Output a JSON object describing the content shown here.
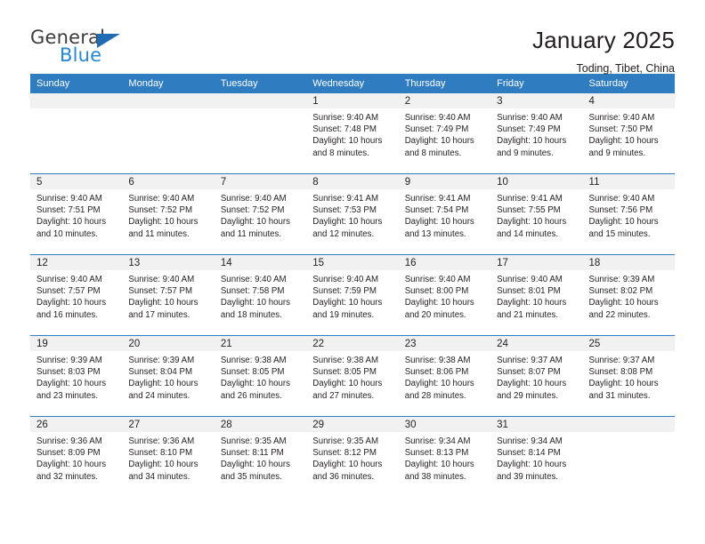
{
  "logo": {
    "word_one": "General",
    "word_two": "Blue",
    "triangle_color": "#1f6cb4",
    "blue_text_color": "#2586d4"
  },
  "header": {
    "title": "January 2025",
    "location": "Toding, Tibet, China",
    "accent_color": "#2f7cc0",
    "band_color": "#f1f1f1"
  },
  "calendar": {
    "weekday_headers": [
      "Sunday",
      "Monday",
      "Tuesday",
      "Wednesday",
      "Thursday",
      "Friday",
      "Saturday"
    ],
    "weeks": [
      [
        {
          "day": "",
          "sunrise": "",
          "sunset": "",
          "daylight_line1": "",
          "daylight_line2": ""
        },
        {
          "day": "",
          "sunrise": "",
          "sunset": "",
          "daylight_line1": "",
          "daylight_line2": ""
        },
        {
          "day": "",
          "sunrise": "",
          "sunset": "",
          "daylight_line1": "",
          "daylight_line2": ""
        },
        {
          "day": "1",
          "sunrise": "Sunrise: 9:40 AM",
          "sunset": "Sunset: 7:48 PM",
          "daylight_line1": "Daylight: 10 hours",
          "daylight_line2": "and 8 minutes."
        },
        {
          "day": "2",
          "sunrise": "Sunrise: 9:40 AM",
          "sunset": "Sunset: 7:49 PM",
          "daylight_line1": "Daylight: 10 hours",
          "daylight_line2": "and 8 minutes."
        },
        {
          "day": "3",
          "sunrise": "Sunrise: 9:40 AM",
          "sunset": "Sunset: 7:49 PM",
          "daylight_line1": "Daylight: 10 hours",
          "daylight_line2": "and 9 minutes."
        },
        {
          "day": "4",
          "sunrise": "Sunrise: 9:40 AM",
          "sunset": "Sunset: 7:50 PM",
          "daylight_line1": "Daylight: 10 hours",
          "daylight_line2": "and 9 minutes."
        }
      ],
      [
        {
          "day": "5",
          "sunrise": "Sunrise: 9:40 AM",
          "sunset": "Sunset: 7:51 PM",
          "daylight_line1": "Daylight: 10 hours",
          "daylight_line2": "and 10 minutes."
        },
        {
          "day": "6",
          "sunrise": "Sunrise: 9:40 AM",
          "sunset": "Sunset: 7:52 PM",
          "daylight_line1": "Daylight: 10 hours",
          "daylight_line2": "and 11 minutes."
        },
        {
          "day": "7",
          "sunrise": "Sunrise: 9:40 AM",
          "sunset": "Sunset: 7:52 PM",
          "daylight_line1": "Daylight: 10 hours",
          "daylight_line2": "and 11 minutes."
        },
        {
          "day": "8",
          "sunrise": "Sunrise: 9:41 AM",
          "sunset": "Sunset: 7:53 PM",
          "daylight_line1": "Daylight: 10 hours",
          "daylight_line2": "and 12 minutes."
        },
        {
          "day": "9",
          "sunrise": "Sunrise: 9:41 AM",
          "sunset": "Sunset: 7:54 PM",
          "daylight_line1": "Daylight: 10 hours",
          "daylight_line2": "and 13 minutes."
        },
        {
          "day": "10",
          "sunrise": "Sunrise: 9:41 AM",
          "sunset": "Sunset: 7:55 PM",
          "daylight_line1": "Daylight: 10 hours",
          "daylight_line2": "and 14 minutes."
        },
        {
          "day": "11",
          "sunrise": "Sunrise: 9:40 AM",
          "sunset": "Sunset: 7:56 PM",
          "daylight_line1": "Daylight: 10 hours",
          "daylight_line2": "and 15 minutes."
        }
      ],
      [
        {
          "day": "12",
          "sunrise": "Sunrise: 9:40 AM",
          "sunset": "Sunset: 7:57 PM",
          "daylight_line1": "Daylight: 10 hours",
          "daylight_line2": "and 16 minutes."
        },
        {
          "day": "13",
          "sunrise": "Sunrise: 9:40 AM",
          "sunset": "Sunset: 7:57 PM",
          "daylight_line1": "Daylight: 10 hours",
          "daylight_line2": "and 17 minutes."
        },
        {
          "day": "14",
          "sunrise": "Sunrise: 9:40 AM",
          "sunset": "Sunset: 7:58 PM",
          "daylight_line1": "Daylight: 10 hours",
          "daylight_line2": "and 18 minutes."
        },
        {
          "day": "15",
          "sunrise": "Sunrise: 9:40 AM",
          "sunset": "Sunset: 7:59 PM",
          "daylight_line1": "Daylight: 10 hours",
          "daylight_line2": "and 19 minutes."
        },
        {
          "day": "16",
          "sunrise": "Sunrise: 9:40 AM",
          "sunset": "Sunset: 8:00 PM",
          "daylight_line1": "Daylight: 10 hours",
          "daylight_line2": "and 20 minutes."
        },
        {
          "day": "17",
          "sunrise": "Sunrise: 9:40 AM",
          "sunset": "Sunset: 8:01 PM",
          "daylight_line1": "Daylight: 10 hours",
          "daylight_line2": "and 21 minutes."
        },
        {
          "day": "18",
          "sunrise": "Sunrise: 9:39 AM",
          "sunset": "Sunset: 8:02 PM",
          "daylight_line1": "Daylight: 10 hours",
          "daylight_line2": "and 22 minutes."
        }
      ],
      [
        {
          "day": "19",
          "sunrise": "Sunrise: 9:39 AM",
          "sunset": "Sunset: 8:03 PM",
          "daylight_line1": "Daylight: 10 hours",
          "daylight_line2": "and 23 minutes."
        },
        {
          "day": "20",
          "sunrise": "Sunrise: 9:39 AM",
          "sunset": "Sunset: 8:04 PM",
          "daylight_line1": "Daylight: 10 hours",
          "daylight_line2": "and 24 minutes."
        },
        {
          "day": "21",
          "sunrise": "Sunrise: 9:38 AM",
          "sunset": "Sunset: 8:05 PM",
          "daylight_line1": "Daylight: 10 hours",
          "daylight_line2": "and 26 minutes."
        },
        {
          "day": "22",
          "sunrise": "Sunrise: 9:38 AM",
          "sunset": "Sunset: 8:05 PM",
          "daylight_line1": "Daylight: 10 hours",
          "daylight_line2": "and 27 minutes."
        },
        {
          "day": "23",
          "sunrise": "Sunrise: 9:38 AM",
          "sunset": "Sunset: 8:06 PM",
          "daylight_line1": "Daylight: 10 hours",
          "daylight_line2": "and 28 minutes."
        },
        {
          "day": "24",
          "sunrise": "Sunrise: 9:37 AM",
          "sunset": "Sunset: 8:07 PM",
          "daylight_line1": "Daylight: 10 hours",
          "daylight_line2": "and 29 minutes."
        },
        {
          "day": "25",
          "sunrise": "Sunrise: 9:37 AM",
          "sunset": "Sunset: 8:08 PM",
          "daylight_line1": "Daylight: 10 hours",
          "daylight_line2": "and 31 minutes."
        }
      ],
      [
        {
          "day": "26",
          "sunrise": "Sunrise: 9:36 AM",
          "sunset": "Sunset: 8:09 PM",
          "daylight_line1": "Daylight: 10 hours",
          "daylight_line2": "and 32 minutes."
        },
        {
          "day": "27",
          "sunrise": "Sunrise: 9:36 AM",
          "sunset": "Sunset: 8:10 PM",
          "daylight_line1": "Daylight: 10 hours",
          "daylight_line2": "and 34 minutes."
        },
        {
          "day": "28",
          "sunrise": "Sunrise: 9:35 AM",
          "sunset": "Sunset: 8:11 PM",
          "daylight_line1": "Daylight: 10 hours",
          "daylight_line2": "and 35 minutes."
        },
        {
          "day": "29",
          "sunrise": "Sunrise: 9:35 AM",
          "sunset": "Sunset: 8:12 PM",
          "daylight_line1": "Daylight: 10 hours",
          "daylight_line2": "and 36 minutes."
        },
        {
          "day": "30",
          "sunrise": "Sunrise: 9:34 AM",
          "sunset": "Sunset: 8:13 PM",
          "daylight_line1": "Daylight: 10 hours",
          "daylight_line2": "and 38 minutes."
        },
        {
          "day": "31",
          "sunrise": "Sunrise: 9:34 AM",
          "sunset": "Sunset: 8:14 PM",
          "daylight_line1": "Daylight: 10 hours",
          "daylight_line2": "and 39 minutes."
        },
        {
          "day": "",
          "sunrise": "",
          "sunset": "",
          "daylight_line1": "",
          "daylight_line2": ""
        }
      ]
    ]
  }
}
